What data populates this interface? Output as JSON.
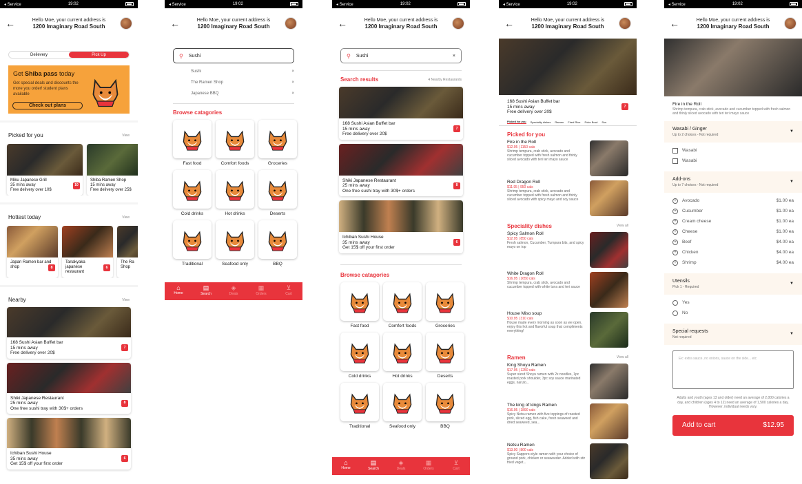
{
  "status": {
    "carrier": "◂ Service",
    "time": "19:02"
  },
  "header": {
    "greeting": "Hello Moe, your current address is",
    "address": "1200 Imaginary Road South"
  },
  "home": {
    "toggle": [
      "Delievery",
      "Pick Up"
    ],
    "promo": {
      "title_pre": "Get ",
      "title_bold": "Shiba pass",
      "title_post": " today",
      "desc": "Get special deals and discounts the more you order! student plans available",
      "button": "Check out plans"
    },
    "picked": {
      "title": "Picked for you",
      "view": "View",
      "items": [
        {
          "name": "Miku Japanese Grill",
          "time": "35 mins away",
          "offer": "Free delivery over 10$",
          "badge": "10"
        },
        {
          "name": "Shiba Ramen Shop",
          "time": "15 mins away",
          "offer": "Free delivery over 25$",
          "badge": ""
        }
      ]
    },
    "hottest": {
      "title": "Hottest today",
      "view": "View",
      "items": [
        {
          "name": "Japan Ramen bar and shop",
          "badge": "8"
        },
        {
          "name": "Tanakyaka japanese restaurant",
          "badge": "6"
        },
        {
          "name": "The Ra Shop",
          "badge": ""
        }
      ]
    },
    "nearby": {
      "title": "Nearby",
      "view": "View",
      "items": [
        {
          "name": "168 Sushi Asian Buffet bar",
          "time": "15 mins away",
          "offer": "Free delivery over 20$",
          "badge": "7"
        },
        {
          "name": "Shiki Japanese Restaurant",
          "time": "25 mins away",
          "offer": "One free sushi tray with 30$+ orders",
          "badge": "8"
        },
        {
          "name": "Ichiban Sushi House",
          "time": "35 mins away",
          "offer": "Get 15$ off your first order",
          "badge": "6"
        }
      ]
    }
  },
  "search": {
    "value": "Sushi",
    "suggestions": [
      "Sushi",
      "The Ramen Shop",
      "Japanese BBQ"
    ],
    "browse_title": "Browse catagories",
    "categories": [
      "Fast food",
      "Comfort foods",
      "Groceries",
      "Cold drinks",
      "Hot drinks",
      "Deserts",
      "Traditional",
      "Seafood only",
      "BBQ"
    ]
  },
  "tabs": [
    "Home",
    "Search",
    "Deals",
    "Orders",
    "Cart"
  ],
  "results": {
    "title": "Search results",
    "count": "4 Nearby Restaurants"
  },
  "restaurant": {
    "name": "168 Sushi Asian Buffet bar",
    "time": "15 mins away",
    "offer": "Free delivery over 20$",
    "badge": "7",
    "menu_tabs": [
      "Picked for you",
      "Speciality dishes",
      "Ramen",
      "Fried Rice",
      "Poke Bowl",
      "Sus"
    ],
    "sections": [
      {
        "title": "Picked for you",
        "view": "",
        "items": [
          {
            "name": "Fire in the Roll",
            "price": "$12.95 | 1150 cals",
            "desc": "Shrimp tempura, crab stick, avocado and cucumber topped with fresh salmon and thinly sliced avocado with teri teri mayo sauce"
          },
          {
            "name": "Red Dragon Roll",
            "price": "$11.95 | 950 cals",
            "desc": "Shrimp tempura, crab stick, avocado and cucumber topped with fresh salmon and thinly sliced avocado with spicy mayo and soy sauce"
          }
        ]
      },
      {
        "title": "Speciality dishes",
        "view": "View all",
        "items": [
          {
            "name": "Spicy Salmon Roll",
            "price": "$12.95 | 850 cals",
            "desc": "Fresh salmon, Cucumber, Tumpura bits, and spicy mayo on top"
          },
          {
            "name": "White Dragon Roll",
            "price": "$16.95 | 1650 cals",
            "desc": "Shrimp tempura, crab stick, avocado and cucumber topped with white tuna and teri sauce"
          },
          {
            "name": "House Miso soup",
            "price": "$10.95 | 310 cals",
            "desc": "House made every morning as soon as we open, enjoy this hot and flavorful soup that compliments everything!"
          }
        ]
      },
      {
        "title": "Ramen",
        "view": "View all",
        "items": [
          {
            "name": "King Shoyu Ramen",
            "price": "$17.95 | 1250 cals",
            "desc": "Super sized Shoyu ramen with 2x noodles, 1pc roasted pork shoulder, 3pc soy sauce marinated eggs, naruto..."
          },
          {
            "name": "The king of kings Ramen",
            "price": "$16.95 | 1890 cals",
            "desc": "Spicy Netsu ramen with five toppings of roasted pork, sliced egg, fish cake, fresh seaweed and dried seaweed, sea..."
          },
          {
            "name": "Netsu Ramen",
            "price": "$13.00 | 800 cals",
            "desc": "Spicy Sapporo-style ramen with your choice of ground pork, chicken or seaweeder. Added with stir fried veget..."
          }
        ]
      }
    ]
  },
  "item": {
    "name": "Fire in the Roll",
    "desc": "Shrimp tempura, crab stick, avocado and cucumber topped with fresh salmon and thinly sliced avocado with teri teri mayo sauce",
    "groups": [
      {
        "title": "Wasabi / Ginger",
        "sub": "Up to 2 choices - Not required",
        "type": "check",
        "options": [
          {
            "label": "Wasabi",
            "price": ""
          },
          {
            "label": "Wasabi",
            "price": ""
          }
        ]
      },
      {
        "title": "Add-ons",
        "sub": "Up to 7 choices - Not required",
        "type": "plus",
        "options": [
          {
            "label": "Avocado",
            "price": "$1.00 ea"
          },
          {
            "label": "Cucumber",
            "price": "$1.00 ea"
          },
          {
            "label": "Cream cheese",
            "price": "$1.00 ea"
          },
          {
            "label": "Cheese",
            "price": "$1.00 ea"
          },
          {
            "label": "Beef",
            "price": "$4.00 ea"
          },
          {
            "label": "Chicken",
            "price": "$4.00 ea"
          },
          {
            "label": "Shrimp",
            "price": "$4.00 ea"
          }
        ]
      },
      {
        "title": "Utensils",
        "sub": "Pick 1 - Required",
        "type": "radio",
        "options": [
          {
            "label": "Yes",
            "price": ""
          },
          {
            "label": "No",
            "price": ""
          }
        ]
      }
    ],
    "special_title": "Special requests",
    "special_sub": "Not required",
    "special_placeholder": "Ex: extra sauce, no onions, sauce on the side... etc",
    "note": "Adults and youth (ages 13 and older) need an average of 2,000 calories a day, and children (ages 4 to 12) need an average of 1,500 calories a day. However, individual needs vary.",
    "cart_label": "Add to cart",
    "cart_price": "$12.95"
  },
  "colors": {
    "accent": "#e8343c",
    "promo": "#f6a23b"
  }
}
